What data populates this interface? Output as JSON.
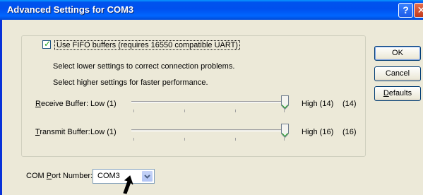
{
  "window": {
    "title": "Advanced Settings for COM3",
    "help_glyph": "?",
    "close_glyph": "✕"
  },
  "fifo": {
    "checked": true,
    "label": "Use FIFO buffers (requires 16550 compatible UART)"
  },
  "hints": {
    "lower": "Select lower settings to correct connection problems.",
    "higher": "Select higher settings for faster performance."
  },
  "receive_buffer": {
    "label_key": "R",
    "label_rest": "eceive Buffer:",
    "low": "Low (1)",
    "high": "High (14)",
    "value": "(14)",
    "level": 1.0
  },
  "transmit_buffer": {
    "label_key": "T",
    "label_rest": "ransmit Buffer:",
    "low": "Low (1)",
    "high": "High (16)",
    "value": "(16)",
    "level": 1.0
  },
  "buttons": {
    "ok": "OK",
    "cancel": "Cancel",
    "defaults_key": "D",
    "defaults_rest": "efaults"
  },
  "com_port": {
    "label_pre": "COM ",
    "label_key": "P",
    "label_rest": "ort Number:",
    "value": "COM3"
  },
  "icons": [
    "help-icon",
    "close-icon",
    "checkmark-icon",
    "slider-thumb-icon",
    "chevron-down-icon",
    "mouse-pointer-icon"
  ]
}
